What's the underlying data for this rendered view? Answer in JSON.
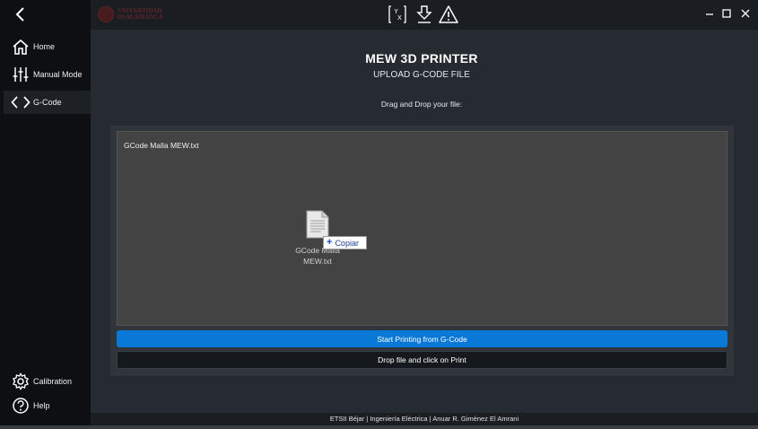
{
  "sidebar": {
    "items": [
      {
        "label": "Home",
        "icon": "home-icon"
      },
      {
        "label": "Manual Mode",
        "icon": "sliders-icon"
      },
      {
        "label": "G-Code",
        "icon": "code-icon"
      },
      {
        "label": "Calibration",
        "icon": "gear-icon"
      },
      {
        "label": "Help",
        "icon": "help-icon"
      }
    ],
    "active": "G-Code"
  },
  "topbar": {
    "logo_line1": "VNIVERSIDAD",
    "logo_line2": "DSALAMANCA",
    "icons": [
      "clear-axis-icon",
      "download-icon",
      "warning-icon"
    ],
    "window_controls": [
      "minimize",
      "maximize",
      "close"
    ]
  },
  "main": {
    "title": "MEW 3D PRINTER",
    "subtitle": "UPLOAD G-CODE FILE",
    "drop_label": "Drag and Drop your file:",
    "dropzone": {
      "filename": "GCode Malla MEW.txt",
      "drag_file_label": "GCode Malla MEW.txt",
      "copy_tooltip": "Copiar"
    },
    "start_button": "Start Printing from G-Code",
    "status_button": "Drop file and click on Print"
  },
  "footer": {
    "text": "ETSII Béjar | Ingeniería Eléctrica | Anuar R. Giménez El Amrani"
  },
  "colors": {
    "accent": "#0a78d6",
    "background": "#262a31",
    "sidebar": "#0d0f12",
    "dropzone": "#434343"
  }
}
